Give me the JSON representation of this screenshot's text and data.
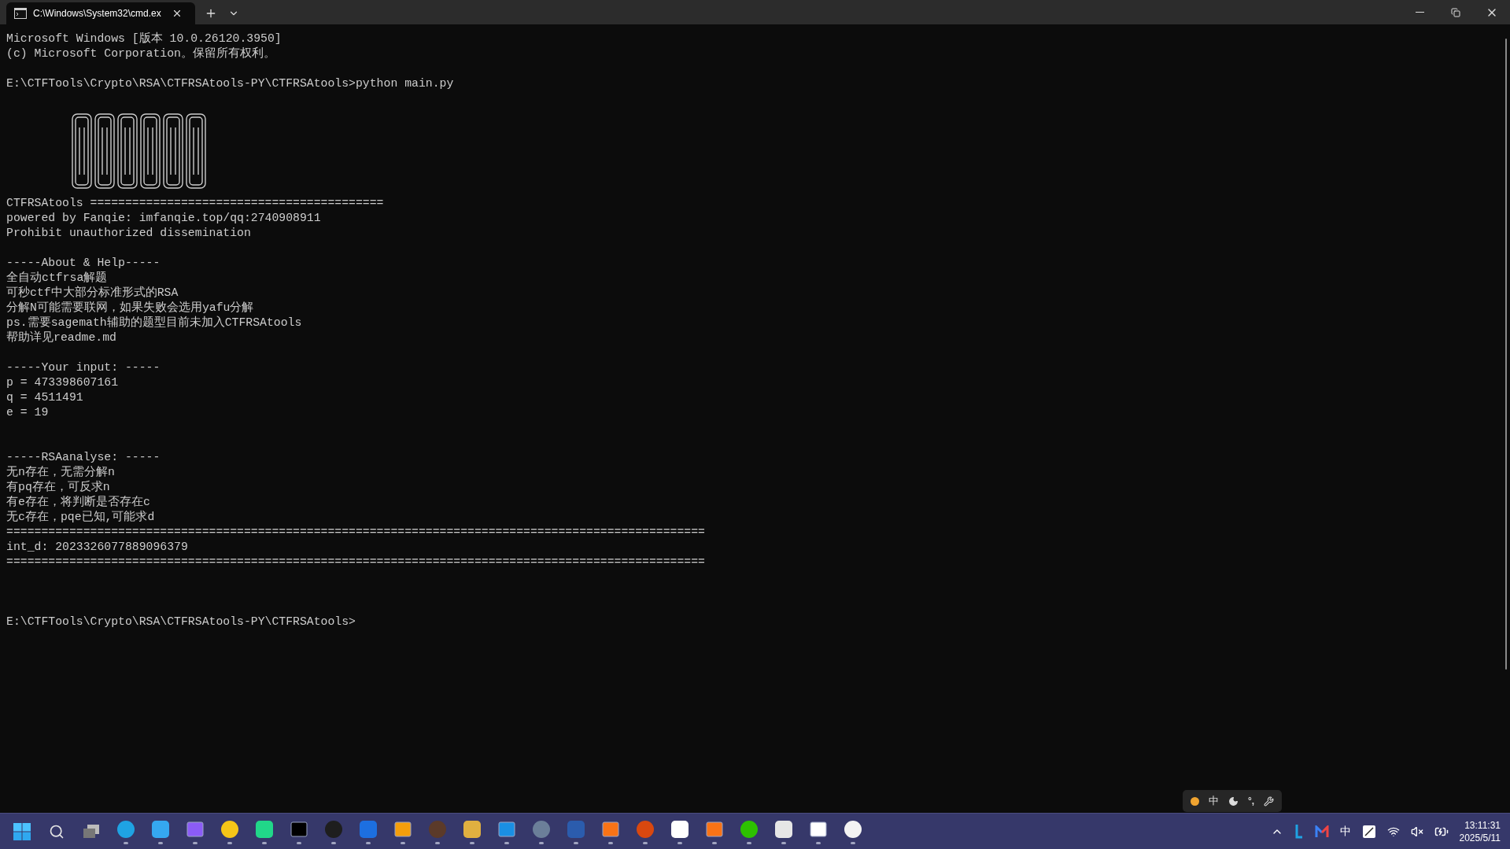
{
  "window": {
    "tabs": [
      {
        "title": "C:\\Windows\\System32\\cmd.ex",
        "selected": true
      }
    ]
  },
  "terminal": {
    "lines": [
      {
        "kind": "text",
        "text": "Microsoft Windows [版本 10.0.26120.3950]"
      },
      {
        "kind": "text",
        "text": "(c) Microsoft Corporation。保留所有权利。"
      },
      {
        "kind": "blank"
      },
      {
        "kind": "text",
        "text": "E:\\CTFTools\\Crypto\\RSA\\CTFRSAtools-PY\\CTFRSAtools>python main.py"
      },
      {
        "kind": "blank"
      },
      {
        "kind": "banner"
      },
      {
        "kind": "text",
        "text": "CTFRSAtools =========================================="
      },
      {
        "kind": "text",
        "text": "powered by Fanqie: imfanqie.top/qq:2740908911"
      },
      {
        "kind": "text",
        "text": "Prohibit unauthorized dissemination"
      },
      {
        "kind": "blank"
      },
      {
        "kind": "text",
        "text": "-----About & Help-----"
      },
      {
        "kind": "text",
        "text": "全自动ctfrsa解题"
      },
      {
        "kind": "text",
        "text": "可秒ctf中大部分标准形式的RSA"
      },
      {
        "kind": "text",
        "text": "分解N可能需要联网，如果失败会选用yafu分解"
      },
      {
        "kind": "text",
        "text": "ps.需要sagemath辅助的题型目前未加入CTFRSAtools"
      },
      {
        "kind": "text",
        "text": "帮助详见readme.md"
      },
      {
        "kind": "blank"
      },
      {
        "kind": "text",
        "text": "-----Your input: -----"
      },
      {
        "kind": "text",
        "text": "p = 473398607161"
      },
      {
        "kind": "text",
        "text": "q = 4511491"
      },
      {
        "kind": "text",
        "text": "e = 19"
      },
      {
        "kind": "blank"
      },
      {
        "kind": "blank"
      },
      {
        "kind": "text",
        "text": "-----RSAanalyse: -----"
      },
      {
        "kind": "text",
        "text": "无n存在，无需分解n"
      },
      {
        "kind": "text",
        "text": "有pq存在，可反求n"
      },
      {
        "kind": "text",
        "text": "有e存在，将判断是否存在c"
      },
      {
        "kind": "text",
        "text": "无c存在，pqe已知,可能求d"
      },
      {
        "kind": "text",
        "text": "===================================================================================================="
      },
      {
        "kind": "text",
        "text": "int_d: 2023326077889096379"
      },
      {
        "kind": "text",
        "text": "===================================================================================================="
      },
      {
        "kind": "blank"
      },
      {
        "kind": "blank"
      },
      {
        "kind": "blank"
      },
      {
        "kind": "text",
        "text": "E:\\CTFTools\\Crypto\\RSA\\CTFRSAtools-PY\\CTFRSAtools>"
      }
    ]
  },
  "ime_toolbar": {
    "mode": "中",
    "punctuation": "°,"
  },
  "taskbar": {
    "apps": [
      {
        "running": true
      },
      {
        "running": true
      },
      {
        "running": true
      },
      {
        "running": true
      },
      {
        "running": true
      },
      {
        "running": true
      },
      {
        "running": true
      },
      {
        "running": true
      },
      {
        "running": true
      },
      {
        "running": true
      },
      {
        "running": true
      },
      {
        "running": true
      },
      {
        "running": true
      },
      {
        "running": true
      },
      {
        "running": true
      },
      {
        "running": true
      },
      {
        "running": true
      },
      {
        "running": true
      },
      {
        "running": true
      },
      {
        "running": true
      },
      {
        "running": true
      },
      {
        "running": true
      }
    ],
    "tray_ime": "中",
    "time": "13:11:31",
    "date": "2025/5/11"
  }
}
